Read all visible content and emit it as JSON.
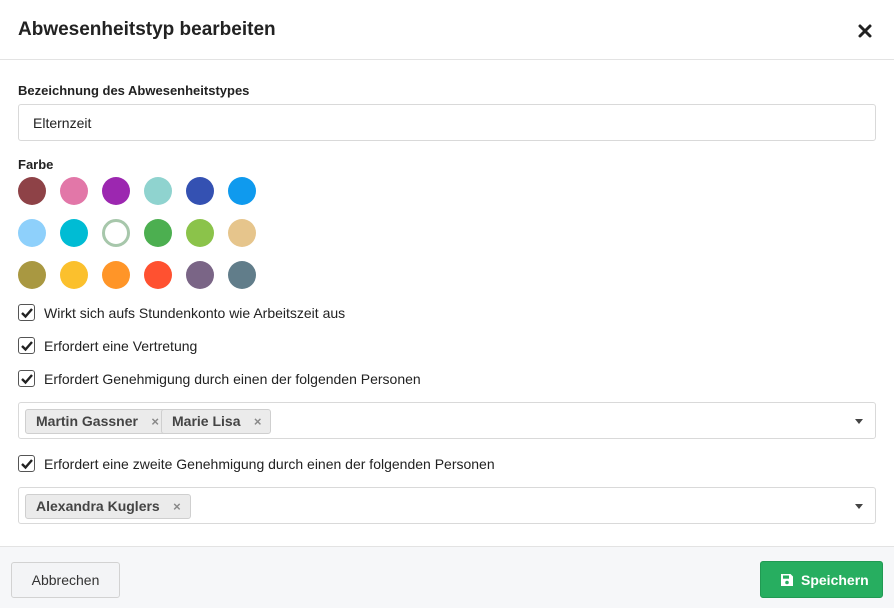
{
  "dialog": {
    "title": "Abwesenheitstyp bearbeiten",
    "close_icon": "close-icon"
  },
  "name_field": {
    "label": "Bezeichnung des Abwesenheitstypes",
    "value": "Elternzeit"
  },
  "color": {
    "label": "Farbe",
    "selected_index": 8,
    "swatches": [
      "#8e4247",
      "#e277a8",
      "#9c27b0",
      "#8fd3cf",
      "#3451b2",
      "#0f9aee",
      "#8ed0fb",
      "#00bcd4",
      "#a7c7ab",
      "#4caf50",
      "#8bc34a",
      "#e6c58c",
      "#a99841",
      "#fbc02d",
      "#ff9528",
      "#ff5130",
      "#7a6586",
      "#617d8a"
    ]
  },
  "options": [
    {
      "label": "Wirkt sich aufs Stundenkonto wie Arbeitszeit aus",
      "checked": true
    },
    {
      "label": "Erfordert eine Vertretung",
      "checked": true
    },
    {
      "label": "Erfordert Genehmigung durch einen der folgenden Personen",
      "checked": true
    },
    {
      "label": "Erfordert eine zweite Genehmigung durch einen der folgenden Personen",
      "checked": true
    }
  ],
  "approvers_first": [
    "Martin Gassner",
    "Marie Lisa"
  ],
  "approvers_second": [
    "Alexandra Kuglers"
  ],
  "tag_remove_symbol": "×",
  "footer": {
    "cancel_label": "Abbrechen",
    "save_label": "Speichern",
    "save_icon": "floppy-disk-icon"
  },
  "colors": {
    "primary_green": "#27ae60",
    "border": "#d9d9d9",
    "footer_bg": "#f6f7f9"
  }
}
